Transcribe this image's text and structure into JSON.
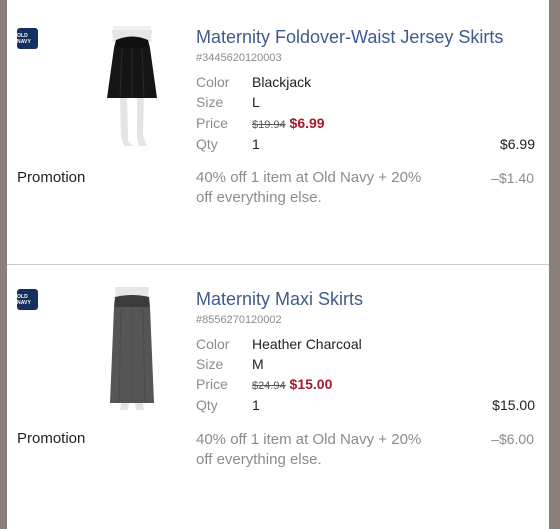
{
  "items": [
    {
      "brand_badge": "OLD NAVY",
      "name": "Maternity Foldover-Waist Jersey Skirts",
      "sku": "#3445620120003",
      "color_label": "Color",
      "color": "Blackjack",
      "size_label": "Size",
      "size": "L",
      "price_label": "Price",
      "original_price": "$19.94",
      "sale_price": "$6.99",
      "qty_label": "Qty",
      "qty": "1",
      "line_total": "$6.99",
      "promotion_label": "Promotion",
      "promotion_text": "40% off 1 item at Old Navy + 20% off everything else.",
      "promotion_amount": "–$1.40",
      "image_icon": "black-skirt-image"
    },
    {
      "brand_badge": "OLD NAVY",
      "name": "Maternity Maxi Skirts",
      "sku": "#8556270120002",
      "color_label": "Color",
      "color": "Heather Charcoal",
      "size_label": "Size",
      "size": "M",
      "price_label": "Price",
      "original_price": "$24.94",
      "sale_price": "$15.00",
      "qty_label": "Qty",
      "qty": "1",
      "line_total": "$15.00",
      "promotion_label": "Promotion",
      "promotion_text": "40% off 1 item at Old Navy + 20% off everything else.",
      "promotion_amount": "–$6.00",
      "image_icon": "charcoal-maxi-skirt-image"
    }
  ],
  "colors": {
    "link": "#3f5a8e",
    "sale": "#a6192e",
    "muted": "#8c8c8c",
    "frame": "#8b7f7a",
    "badge": "#14305e"
  }
}
